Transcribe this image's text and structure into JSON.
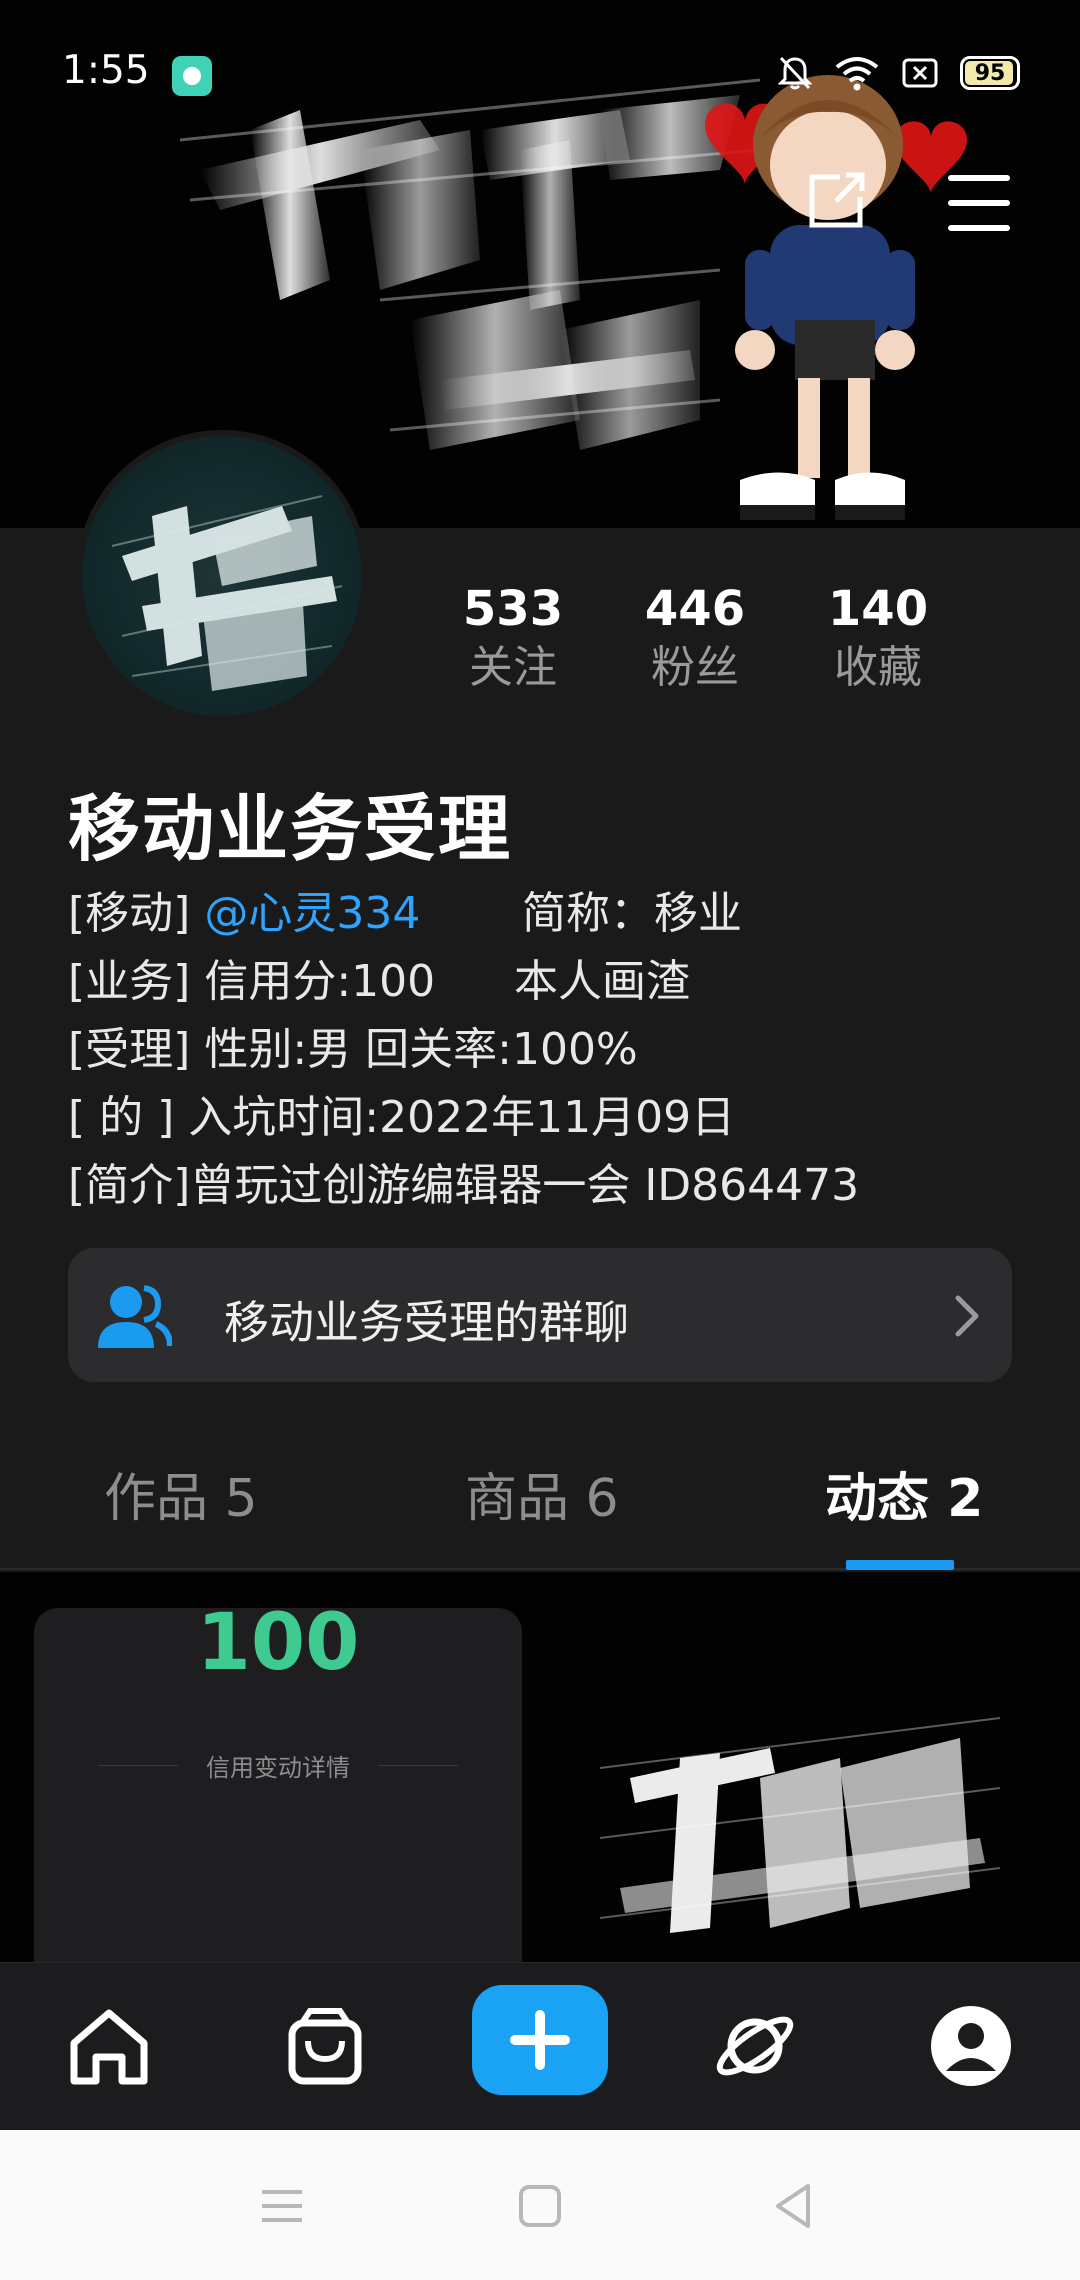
{
  "status_bar": {
    "time": "1:55",
    "battery": "95",
    "icons": [
      "app-notification-icon",
      "mute-icon",
      "wifi-icon",
      "sim-icon",
      "battery-icon"
    ]
  },
  "header": {
    "banner_icons": [
      "share-icon",
      "menu-icon"
    ]
  },
  "profile": {
    "stats": [
      {
        "value": "533",
        "label": "关注"
      },
      {
        "value": "446",
        "label": "粉丝"
      },
      {
        "value": "140",
        "label": "收藏"
      }
    ],
    "name": "移动业务受理",
    "bio": [
      {
        "prefix": "[移动] ",
        "mention": "@心灵334",
        "right": "简称：移业"
      },
      {
        "prefix": "[业务]  信用分:100",
        "right": "本人画渣"
      },
      {
        "prefix": "[受理] 性别:男  回关率:100%"
      },
      {
        "prefix": "[  的  ] 入坑时间:2022年11月09日"
      },
      {
        "prefix": "[简介]曾玩过创游编辑器一会 ID864473"
      }
    ],
    "group_chat": "移动业务受理的群聊"
  },
  "tabs": [
    {
      "label": "作品 5",
      "active": false
    },
    {
      "label": "商品 6",
      "active": false
    },
    {
      "label": "动态 2",
      "active": true
    }
  ],
  "posts": [
    {
      "score": "100",
      "caption": "信用变动详情"
    }
  ],
  "colors": {
    "accent": "#1aa3f5",
    "background": "#1a1a1b",
    "mention": "#2fa4ff",
    "score_green": "#3fca8f"
  },
  "bottom_nav": {
    "items": [
      "home-icon",
      "shopping-bag-icon",
      "plus-icon",
      "planet-icon",
      "profile-icon"
    ]
  },
  "system_nav": [
    "menu-nav-icon",
    "home-nav-icon",
    "back-nav-icon"
  ]
}
